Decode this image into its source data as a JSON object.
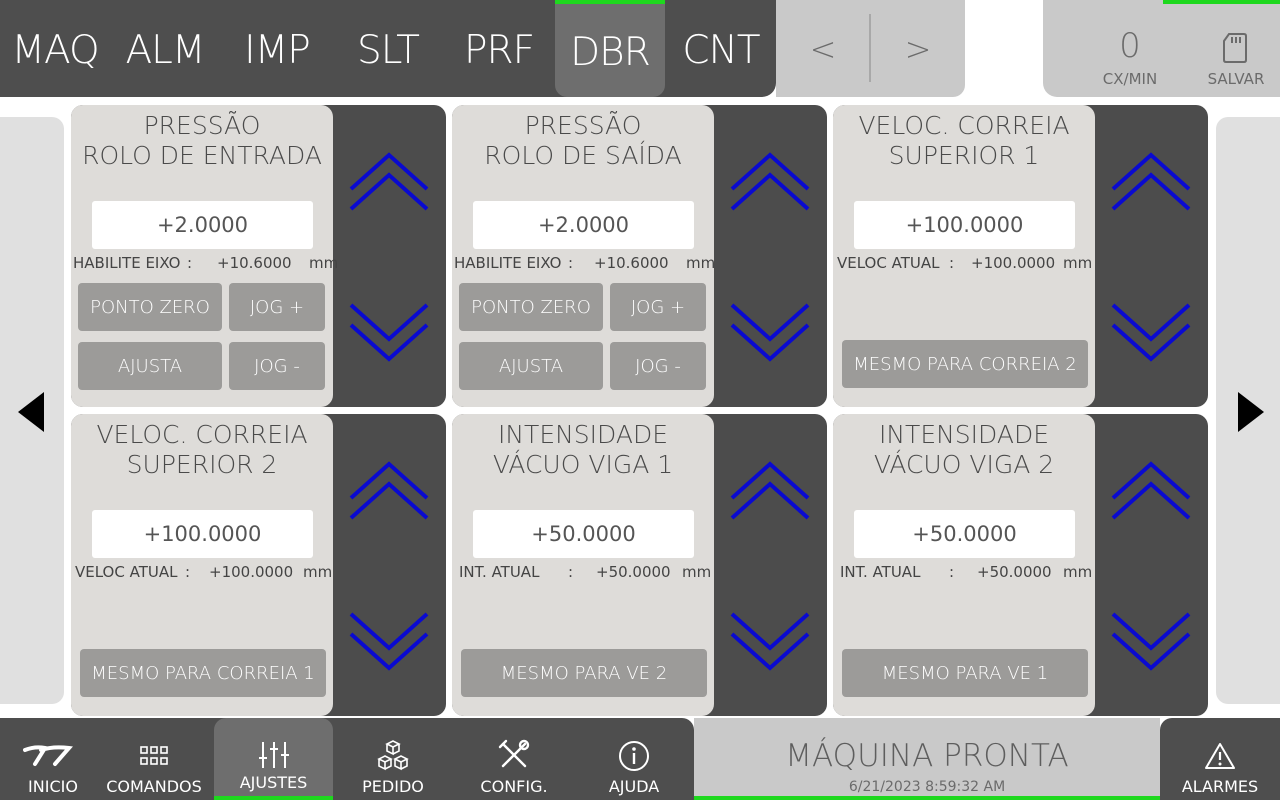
{
  "header": {
    "tabs": [
      {
        "label": "MAQ"
      },
      {
        "label": "ALM"
      },
      {
        "label": "IMP"
      },
      {
        "label": "SLT"
      },
      {
        "label": "PRF"
      },
      {
        "label": "DBR",
        "active": true
      },
      {
        "label": "CNT"
      }
    ],
    "prev_label": "<",
    "next_label": ">",
    "counter_value": "0",
    "counter_unit": "CX/MIN",
    "save_label": "SALVAR"
  },
  "panels": [
    {
      "title_line1": "PRESSÃO",
      "title_line2": "ROLO DE ENTRADA",
      "value": "+2.0000",
      "info_label": "HABILITE EIXO",
      "info_sep": ":",
      "info_value": "+10.6000",
      "info_unit": "mm",
      "buttons": {
        "zero": "PONTO ZERO",
        "jog_plus": "JOG +",
        "adjust": "AJUSTA",
        "jog_minus": "JOG -"
      }
    },
    {
      "title_line1": "PRESSÃO",
      "title_line2": "ROLO DE SAÍDA",
      "value": "+2.0000",
      "info_label": "HABILITE EIXO",
      "info_sep": ":",
      "info_value": "+10.6000",
      "info_unit": "mm",
      "buttons": {
        "zero": "PONTO ZERO",
        "jog_plus": "JOG +",
        "adjust": "AJUSTA",
        "jog_minus": "JOG -"
      }
    },
    {
      "title_line1": "VELOC. CORREIA",
      "title_line2": "SUPERIOR 1",
      "value": "+100.0000",
      "info_label": "VELOC ATUAL",
      "info_sep": ":",
      "info_value": "+100.0000",
      "info_unit": "mm",
      "wide_button": "MESMO PARA CORREIA 2"
    },
    {
      "title_line1": "VELOC. CORREIA",
      "title_line2": "SUPERIOR 2",
      "value": "+100.0000",
      "info_label": "VELOC ATUAL",
      "info_sep": ":",
      "info_value": "+100.0000",
      "info_unit": "mm",
      "wide_button": "MESMO PARA CORREIA 1"
    },
    {
      "title_line1": "INTENSIDADE",
      "title_line2": "VÁCUO VIGA 1",
      "value": "+50.0000",
      "info_label": "INT. ATUAL",
      "info_sep": ":",
      "info_value": "+50.0000",
      "info_unit": "mm",
      "wide_button": "MESMO PARA VE 2"
    },
    {
      "title_line1": "INTENSIDADE",
      "title_line2": "VÁCUO VIGA 2",
      "value": "+50.0000",
      "info_label": "INT. ATUAL",
      "info_sep": ":",
      "info_value": "+50.0000",
      "info_unit": "mm",
      "wide_button": "MESMO PARA VE 1"
    }
  ],
  "footer": {
    "nav": [
      {
        "label": "INICIO",
        "icon": "logo-icon"
      },
      {
        "label": "COMANDOS",
        "icon": "grid-icon"
      },
      {
        "label": "AJUSTES",
        "icon": "sliders-icon",
        "active": true
      },
      {
        "label": "PEDIDO",
        "icon": "boxes-icon"
      },
      {
        "label": "CONFIG.",
        "icon": "tools-icon"
      },
      {
        "label": "AJUDA",
        "icon": "info-icon"
      }
    ],
    "status_text": "MÁQUINA PRONTA",
    "status_time": "6/21/2023 8:59:32 AM",
    "alarm_label": "ALARMES"
  },
  "colors": {
    "accent_green": "#1ed81e",
    "arrow_blue": "#0a0ad0",
    "dark_bar": "#4e4e4e",
    "panel_face": "#dedcd9"
  }
}
